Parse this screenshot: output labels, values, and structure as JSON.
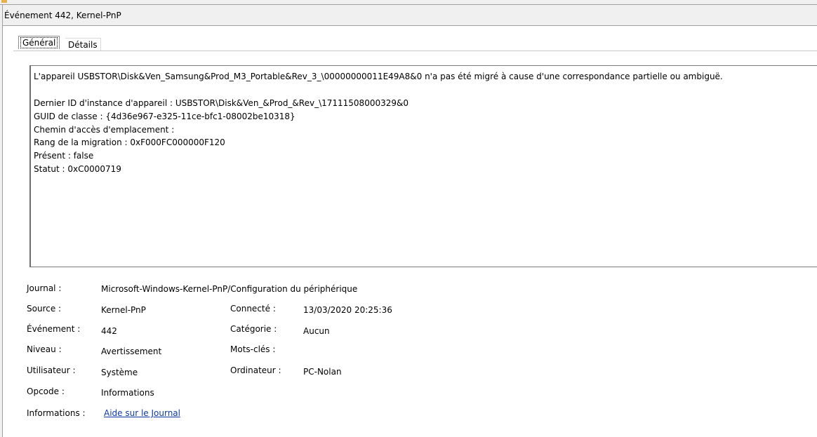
{
  "window": {
    "title": "Événement 442, Kernel-PnP"
  },
  "tabs": {
    "general": "Général",
    "details": "Détails"
  },
  "message": {
    "line1": "L'appareil USBSTOR\\Disk&Ven_Samsung&Prod_M3_Portable&Rev_3_\\00000000011E49A8&0 n'a pas été migré à cause d'une correspondance partielle ou ambiguë.",
    "line2": "Dernier ID d'instance d'appareil : USBSTOR\\Disk&Ven_&Prod_&Rev_\\17111508000329&0",
    "line3": "GUID de classe : {4d36e967-e325-11ce-bfc1-08002be10318}",
    "line4": "Chemin d'accès d'emplacement :",
    "line5": "Rang de la migration : 0xF000FC000000F120",
    "line6": "Présent : false",
    "line7": "Statut : 0xC0000719"
  },
  "fields": {
    "journal_label": "Journal :",
    "journal_value": "Microsoft-Windows-Kernel-PnP/Configuration du périphérique",
    "source_label": "Source :",
    "source_value": "Kernel-PnP",
    "connected_label": "Connecté :",
    "connected_value": "13/03/2020 20:25:36",
    "event_label": "Événement :",
    "event_value": "442",
    "category_label": "Catégorie :",
    "category_value": "Aucun",
    "level_label": "Niveau :",
    "level_value": "Avertissement",
    "keywords_label": "Mots-clés :",
    "keywords_value": "",
    "user_label": "Utilisateur :",
    "user_value": "Système",
    "computer_label": "Ordinateur :",
    "computer_value": "PC-Nolan",
    "opcode_label": "Opcode :",
    "opcode_value": "Informations",
    "info_label": "Informations :",
    "info_link": "Aide sur le Journal"
  }
}
